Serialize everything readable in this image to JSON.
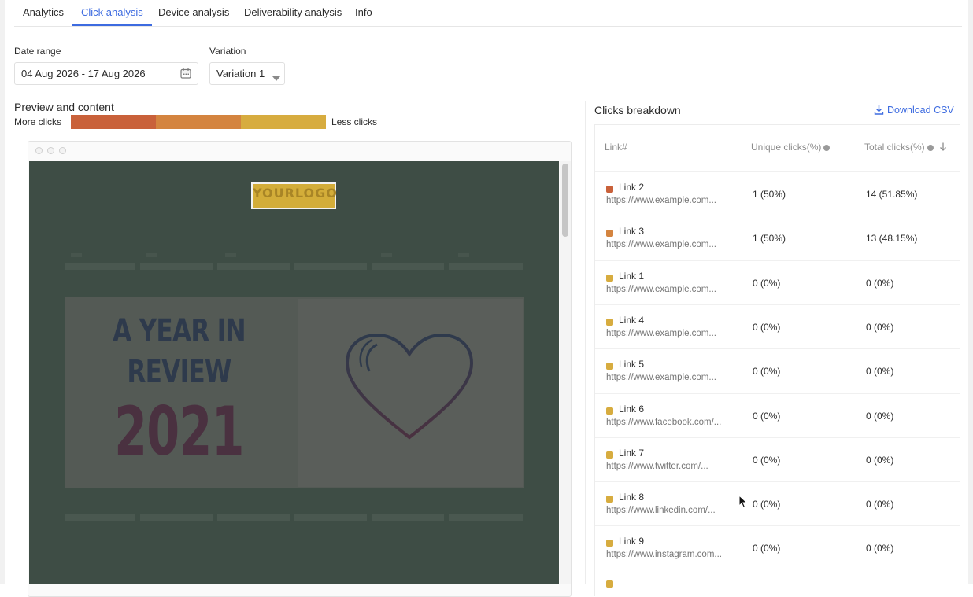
{
  "tabs": [
    {
      "label": "Analytics"
    },
    {
      "label": "Click analysis"
    },
    {
      "label": "Device analysis"
    },
    {
      "label": "Deliverability analysis"
    },
    {
      "label": "Info"
    }
  ],
  "filters": {
    "date_range_label": "Date range",
    "date_range_value": "04 Aug 2026 - 17 Aug 2026",
    "variation_label": "Variation",
    "variation_value": "Variation 1"
  },
  "preview": {
    "title": "Preview and content",
    "legend_more": "More clicks",
    "legend_less": "Less clicks",
    "legend_colors": [
      "#c9613a",
      "#d4843f",
      "#d7ac3f"
    ],
    "email": {
      "logo_text": "YOURLOGO",
      "headline_line1": "A YEAR IN",
      "headline_line2": "REVIEW",
      "year": "2021"
    }
  },
  "breakdown": {
    "title": "Clicks breakdown",
    "download_label": "Download CSV",
    "columns": {
      "link": "Link#",
      "unique": "Unique clicks(%)",
      "total": "Total clicks(%)"
    },
    "rows": [
      {
        "name": "Link 2",
        "url": "https://www.example.com...",
        "unique": "1 (50%)",
        "total": "14 (51.85%)",
        "color": "#c9613a"
      },
      {
        "name": "Link 3",
        "url": "https://www.example.com...",
        "unique": "1 (50%)",
        "total": "13 (48.15%)",
        "color": "#d4843f"
      },
      {
        "name": "Link 1",
        "url": "https://www.example.com...",
        "unique": "0 (0%)",
        "total": "0 (0%)",
        "color": "#d7ac3f"
      },
      {
        "name": "Link 4",
        "url": "https://www.example.com...",
        "unique": "0 (0%)",
        "total": "0 (0%)",
        "color": "#d7ac3f"
      },
      {
        "name": "Link 5",
        "url": "https://www.example.com...",
        "unique": "0 (0%)",
        "total": "0 (0%)",
        "color": "#d7ac3f"
      },
      {
        "name": "Link 6",
        "url": "https://www.facebook.com/...",
        "unique": "0 (0%)",
        "total": "0 (0%)",
        "color": "#d7ac3f"
      },
      {
        "name": "Link 7",
        "url": "https://www.twitter.com/...",
        "unique": "0 (0%)",
        "total": "0 (0%)",
        "color": "#d7ac3f"
      },
      {
        "name": "Link 8",
        "url": "https://www.linkedin.com/...",
        "unique": "0 (0%)",
        "total": "0 (0%)",
        "color": "#d7ac3f"
      },
      {
        "name": "Link 9",
        "url": "https://www.instagram.com...",
        "unique": "0 (0%)",
        "total": "0 (0%)",
        "color": "#d7ac3f"
      }
    ]
  },
  "colors": {
    "accent": "#3d6be0",
    "preview_bg": "#3e4d45"
  }
}
